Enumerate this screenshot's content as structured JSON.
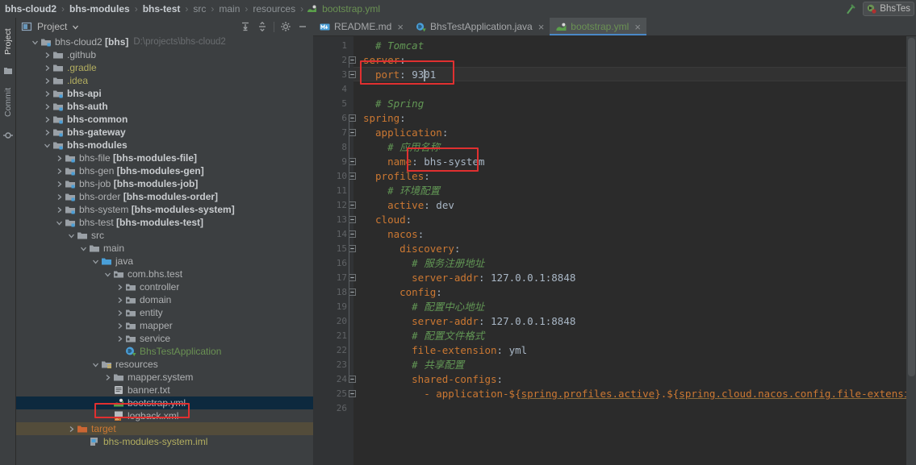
{
  "breadcrumb": {
    "items": [
      {
        "label": "bhs-cloud2",
        "style": "bold"
      },
      {
        "label": "bhs-modules",
        "style": "bold"
      },
      {
        "label": "bhs-test",
        "style": "bold"
      },
      {
        "label": "src",
        "style": "dim"
      },
      {
        "label": "main",
        "style": "dim"
      },
      {
        "label": "resources",
        "style": "dim"
      },
      {
        "label": "bootstrap.yml",
        "style": "file"
      }
    ],
    "separator": "›"
  },
  "toolbar_right": {
    "build_icon": "hammer-icon",
    "run_config_label": "BhsTes",
    "run_config_icon": "spring-boot-run-icon"
  },
  "tool_strip": {
    "tabs": [
      {
        "label": "Project",
        "icon": "project-icon",
        "active": true
      },
      {
        "label": "Commit",
        "icon": "commit-icon",
        "active": false
      }
    ]
  },
  "project_panel": {
    "title": "Project",
    "title_icon": "project-window-icon",
    "dropdown_icon": "chevron-down-icon",
    "actions": [
      {
        "name": "expand-all-icon",
        "tooltip": "Expand All"
      },
      {
        "name": "collapse-all-icon",
        "tooltip": "Collapse All"
      },
      {
        "name": "gear-icon",
        "tooltip": "Settings"
      },
      {
        "name": "minimize-icon",
        "tooltip": "Hide"
      }
    ],
    "tree": [
      {
        "indent": 0,
        "arrow": "down",
        "icon": "module-folder",
        "label": "bhs-cloud2 ",
        "bold_suffix": "[bhs]",
        "path": "D:\\projects\\bhs-cloud2",
        "color": "normal"
      },
      {
        "indent": 1,
        "arrow": "right",
        "icon": "folder",
        "label": ".github",
        "color": "normal"
      },
      {
        "indent": 1,
        "arrow": "right",
        "icon": "folder",
        "label": ".gradle",
        "color": "yellow"
      },
      {
        "indent": 1,
        "arrow": "right",
        "icon": "folder",
        "label": ".idea",
        "color": "yellow"
      },
      {
        "indent": 1,
        "arrow": "right",
        "icon": "module-folder",
        "label": "",
        "bold_suffix": "bhs-api",
        "color": "normal"
      },
      {
        "indent": 1,
        "arrow": "right",
        "icon": "module-folder",
        "label": "",
        "bold_suffix": "bhs-auth",
        "color": "normal"
      },
      {
        "indent": 1,
        "arrow": "right",
        "icon": "module-folder",
        "label": "",
        "bold_suffix": "bhs-common",
        "color": "normal"
      },
      {
        "indent": 1,
        "arrow": "right",
        "icon": "module-folder",
        "label": "",
        "bold_suffix": "bhs-gateway",
        "color": "normal"
      },
      {
        "indent": 1,
        "arrow": "down",
        "icon": "module-folder",
        "label": "",
        "bold_suffix": "bhs-modules",
        "color": "normal"
      },
      {
        "indent": 2,
        "arrow": "right",
        "icon": "module-folder",
        "label": "bhs-file ",
        "bold_suffix": "[bhs-modules-file]",
        "color": "normal"
      },
      {
        "indent": 2,
        "arrow": "right",
        "icon": "module-folder",
        "label": "bhs-gen ",
        "bold_suffix": "[bhs-modules-gen]",
        "color": "normal"
      },
      {
        "indent": 2,
        "arrow": "right",
        "icon": "module-folder",
        "label": "bhs-job ",
        "bold_suffix": "[bhs-modules-job]",
        "color": "normal"
      },
      {
        "indent": 2,
        "arrow": "right",
        "icon": "module-folder",
        "label": "bhs-order ",
        "bold_suffix": "[bhs-modules-order]",
        "color": "normal"
      },
      {
        "indent": 2,
        "arrow": "right",
        "icon": "module-folder",
        "label": "bhs-system ",
        "bold_suffix": "[bhs-modules-system]",
        "color": "normal"
      },
      {
        "indent": 2,
        "arrow": "down",
        "icon": "module-folder",
        "label": "bhs-test ",
        "bold_suffix": "[bhs-modules-test]",
        "color": "normal"
      },
      {
        "indent": 3,
        "arrow": "down",
        "icon": "folder",
        "label": "src",
        "color": "normal"
      },
      {
        "indent": 4,
        "arrow": "down",
        "icon": "folder",
        "label": "main",
        "color": "normal"
      },
      {
        "indent": 5,
        "arrow": "down",
        "icon": "source-folder",
        "label": "java",
        "color": "normal"
      },
      {
        "indent": 6,
        "arrow": "down",
        "icon": "package",
        "label": "com.bhs.test",
        "color": "normal"
      },
      {
        "indent": 7,
        "arrow": "right",
        "icon": "package",
        "label": "controller",
        "color": "normal"
      },
      {
        "indent": 7,
        "arrow": "right",
        "icon": "package",
        "label": "domain",
        "color": "normal"
      },
      {
        "indent": 7,
        "arrow": "right",
        "icon": "package",
        "label": "entity",
        "color": "normal"
      },
      {
        "indent": 7,
        "arrow": "right",
        "icon": "package",
        "label": "mapper",
        "color": "normal"
      },
      {
        "indent": 7,
        "arrow": "right",
        "icon": "package",
        "label": "service",
        "color": "normal"
      },
      {
        "indent": 7,
        "arrow": "none",
        "icon": "spring-class",
        "label": "BhsTestApplication",
        "color": "green"
      },
      {
        "indent": 5,
        "arrow": "down",
        "icon": "resource-folder",
        "label": "resources",
        "color": "normal"
      },
      {
        "indent": 6,
        "arrow": "right",
        "icon": "folder",
        "label": "mapper.system",
        "color": "normal"
      },
      {
        "indent": 6,
        "arrow": "none",
        "icon": "text-file",
        "label": "banner.txt",
        "color": "normal"
      },
      {
        "indent": 6,
        "arrow": "none",
        "icon": "yml-file",
        "label": "bootstrap.yml",
        "color": "normal",
        "selected": true,
        "highlighted": true
      },
      {
        "indent": 6,
        "arrow": "none",
        "icon": "xml-file",
        "label": "logback.xml",
        "color": "normal"
      },
      {
        "indent": 3,
        "arrow": "right",
        "icon": "target-folder",
        "label": "target",
        "color": "orange",
        "row_style": "target"
      },
      {
        "indent": 4,
        "arrow": "none",
        "icon": "iml-file",
        "label": "bhs-modules-system.iml",
        "color": "yellow"
      }
    ]
  },
  "editor": {
    "tabs": [
      {
        "label": "README.md",
        "icon": "markdown-icon",
        "active": false,
        "color": "normal"
      },
      {
        "label": "BhsTestApplication.java",
        "icon": "spring-class-icon",
        "active": false,
        "color": "normal"
      },
      {
        "label": "bootstrap.yml",
        "icon": "yml-icon",
        "active": true,
        "color": "green"
      }
    ],
    "close_glyph": "×",
    "active_tab": "bootstrap.yml",
    "cursor_line": 3,
    "line_count": 26,
    "lines": [
      {
        "n": 1,
        "indent": 1,
        "tokens": [
          {
            "t": "comment",
            "s": "# Tomcat"
          }
        ]
      },
      {
        "n": 2,
        "indent": 0,
        "tokens": [
          {
            "t": "key",
            "s": "server"
          },
          {
            "t": "pun",
            "s": ":"
          }
        ],
        "fold": "open"
      },
      {
        "n": 3,
        "indent": 1,
        "tokens": [
          {
            "t": "key",
            "s": "port"
          },
          {
            "t": "pun",
            "s": ": "
          },
          {
            "t": "num",
            "s": "9301"
          }
        ],
        "fold": "end"
      },
      {
        "n": 4,
        "indent": 0,
        "tokens": []
      },
      {
        "n": 5,
        "indent": 1,
        "tokens": [
          {
            "t": "comment",
            "s": "# Spring"
          }
        ]
      },
      {
        "n": 6,
        "indent": 0,
        "tokens": [
          {
            "t": "key",
            "s": "spring"
          },
          {
            "t": "pun",
            "s": ":"
          }
        ],
        "fold": "open"
      },
      {
        "n": 7,
        "indent": 1,
        "tokens": [
          {
            "t": "key",
            "s": "application"
          },
          {
            "t": "pun",
            "s": ":"
          }
        ],
        "fold": "open"
      },
      {
        "n": 8,
        "indent": 2,
        "tokens": [
          {
            "t": "comment",
            "s": "# 应用名称"
          }
        ]
      },
      {
        "n": 9,
        "indent": 2,
        "tokens": [
          {
            "t": "key",
            "s": "name"
          },
          {
            "t": "pun",
            "s": ": "
          },
          {
            "t": "val",
            "s": "bhs-system"
          }
        ],
        "fold": "end"
      },
      {
        "n": 10,
        "indent": 1,
        "tokens": [
          {
            "t": "key",
            "s": "profiles"
          },
          {
            "t": "pun",
            "s": ":"
          }
        ],
        "fold": "open"
      },
      {
        "n": 11,
        "indent": 2,
        "tokens": [
          {
            "t": "comment",
            "s": "# 环境配置"
          }
        ]
      },
      {
        "n": 12,
        "indent": 2,
        "tokens": [
          {
            "t": "key",
            "s": "active"
          },
          {
            "t": "pun",
            "s": ": "
          },
          {
            "t": "val",
            "s": "dev"
          }
        ],
        "fold": "end"
      },
      {
        "n": 13,
        "indent": 1,
        "tokens": [
          {
            "t": "key",
            "s": "cloud"
          },
          {
            "t": "pun",
            "s": ":"
          }
        ],
        "fold": "open"
      },
      {
        "n": 14,
        "indent": 2,
        "tokens": [
          {
            "t": "key",
            "s": "nacos"
          },
          {
            "t": "pun",
            "s": ":"
          }
        ],
        "fold": "open"
      },
      {
        "n": 15,
        "indent": 3,
        "tokens": [
          {
            "t": "key",
            "s": "discovery"
          },
          {
            "t": "pun",
            "s": ":"
          }
        ],
        "fold": "open"
      },
      {
        "n": 16,
        "indent": 4,
        "tokens": [
          {
            "t": "comment",
            "s": "# 服务注册地址"
          }
        ]
      },
      {
        "n": 17,
        "indent": 4,
        "tokens": [
          {
            "t": "key",
            "s": "server-addr"
          },
          {
            "t": "pun",
            "s": ": "
          },
          {
            "t": "num",
            "s": "127.0.0.1:8848"
          }
        ],
        "fold": "end"
      },
      {
        "n": 18,
        "indent": 3,
        "tokens": [
          {
            "t": "key",
            "s": "config"
          },
          {
            "t": "pun",
            "s": ":"
          }
        ],
        "fold": "open"
      },
      {
        "n": 19,
        "indent": 4,
        "tokens": [
          {
            "t": "comment",
            "s": "# 配置中心地址"
          }
        ]
      },
      {
        "n": 20,
        "indent": 4,
        "tokens": [
          {
            "t": "key",
            "s": "server-addr"
          },
          {
            "t": "pun",
            "s": ": "
          },
          {
            "t": "num",
            "s": "127.0.0.1:8848"
          }
        ]
      },
      {
        "n": 21,
        "indent": 4,
        "tokens": [
          {
            "t": "comment",
            "s": "# 配置文件格式"
          }
        ]
      },
      {
        "n": 22,
        "indent": 4,
        "tokens": [
          {
            "t": "key",
            "s": "file-extension"
          },
          {
            "t": "pun",
            "s": ": "
          },
          {
            "t": "val",
            "s": "yml"
          }
        ]
      },
      {
        "n": 23,
        "indent": 4,
        "tokens": [
          {
            "t": "comment",
            "s": "# 共享配置"
          }
        ]
      },
      {
        "n": 24,
        "indent": 4,
        "tokens": [
          {
            "t": "key",
            "s": "shared-configs"
          },
          {
            "t": "pun",
            "s": ":"
          }
        ],
        "fold": "open"
      },
      {
        "n": 25,
        "indent": 5,
        "tokens": [
          {
            "t": "key",
            "s": "- application-${"
          },
          {
            "t": "var",
            "s": "spring.profiles.active"
          },
          {
            "t": "brace",
            "s": "}.${"
          },
          {
            "t": "var",
            "s": "spring.cloud.nacos.config.file-extension"
          },
          {
            "t": "brace",
            "s": "}"
          }
        ],
        "fold": "end"
      },
      {
        "n": 26,
        "indent": 0,
        "tokens": []
      }
    ],
    "highlights": [
      {
        "name": "port-value-highlight",
        "target_line": 3
      },
      {
        "name": "app-name-highlight",
        "target_line": 9
      }
    ]
  },
  "colors": {
    "panel_bg": "#3c3f41",
    "editor_bg": "#2b2b2b",
    "gutter_bg": "#313335",
    "selection_bg": "#0d293e",
    "highlight_border": "#e03030",
    "accent_tab": "#4a88c7",
    "comment_green": "#629755",
    "key_orange": "#cc7832",
    "text_default": "#a9b7c6",
    "file_green": "#6a9153",
    "folder_yellow": "#b3ae60",
    "target_row": "#534c3a"
  }
}
